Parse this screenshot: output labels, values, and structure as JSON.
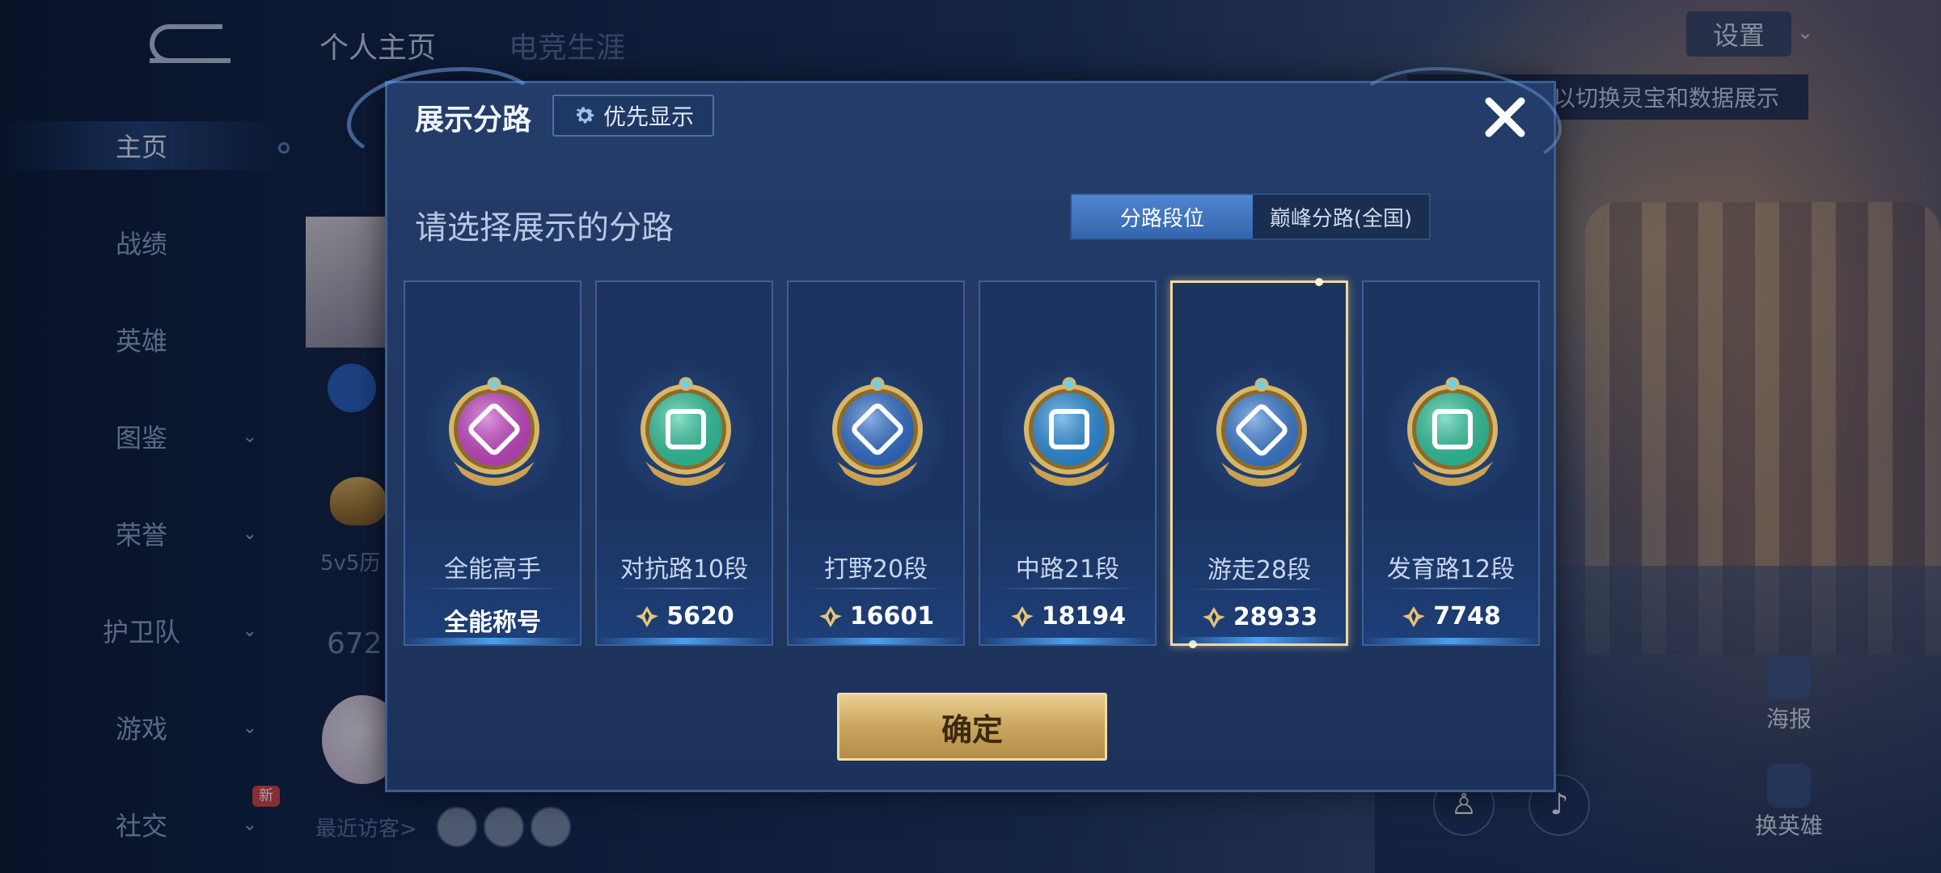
{
  "nav": {
    "items": [
      {
        "label": "主页"
      },
      {
        "label": "战绩"
      },
      {
        "label": "英雄"
      },
      {
        "label": "图鉴"
      },
      {
        "label": "荣誉"
      },
      {
        "label": "护卫队"
      },
      {
        "label": "游戏"
      },
      {
        "label": "社交"
      }
    ],
    "new_badge": "新"
  },
  "header": {
    "tabs": [
      "个人主页",
      "电竞生涯"
    ],
    "settings_label": "设置",
    "hint_text": "以切换灵宝和数据展示"
  },
  "background": {
    "side_text_1": "5v5历",
    "side_text_2": "672",
    "visitors_label": "最近访客>",
    "poster_label": "海报",
    "swap_hero_label": "换英雄"
  },
  "dialog": {
    "title": "展示分路",
    "priority_label": "优先显示",
    "subheading": "请选择展示的分路",
    "tabs": [
      {
        "label": "分路段位",
        "active": true
      },
      {
        "label": "巅峰分路(全国)",
        "active": false
      }
    ],
    "cards": [
      {
        "rank": "全能高手",
        "value": "全能称号",
        "has_icon": false,
        "emblem_color": "#c845c8",
        "selected": false
      },
      {
        "rank": "对抗路10段",
        "value": "5620",
        "has_icon": true,
        "emblem_color": "#2fc9a0",
        "selected": false
      },
      {
        "rank": "打野20段",
        "value": "16601",
        "has_icon": true,
        "emblem_color": "#2f6fd0",
        "selected": false
      },
      {
        "rank": "中路21段",
        "value": "18194",
        "has_icon": true,
        "emblem_color": "#2a8fe0",
        "selected": false
      },
      {
        "rank": "游走28段",
        "value": "28933",
        "has_icon": true,
        "emblem_color": "#3a7ed8",
        "selected": true
      },
      {
        "rank": "发育路12段",
        "value": "7748",
        "has_icon": true,
        "emblem_color": "#2fc9a0",
        "selected": false
      }
    ],
    "confirm_label": "确定"
  },
  "colors": {
    "accent_gold": "#caa55e",
    "selected_border": "#f2d99a",
    "tab_active": "#3f78c2"
  }
}
